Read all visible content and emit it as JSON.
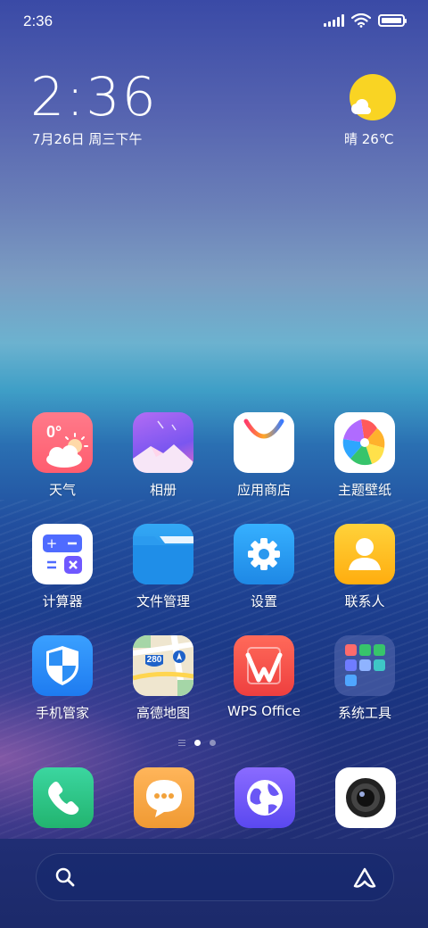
{
  "status_bar": {
    "time": "2:36"
  },
  "clock_widget": {
    "time": "2:36",
    "date": "7月26日 周三下午"
  },
  "weather_widget": {
    "text": "晴 26℃"
  },
  "apps": [
    {
      "label": "天气",
      "icon": "weather-icon",
      "badge": "0°"
    },
    {
      "label": "相册",
      "icon": "gallery-icon"
    },
    {
      "label": "应用商店",
      "icon": "app-store-icon"
    },
    {
      "label": "主题壁纸",
      "icon": "themes-icon"
    },
    {
      "label": "计算器",
      "icon": "calculator-icon"
    },
    {
      "label": "文件管理",
      "icon": "file-manager-icon"
    },
    {
      "label": "设置",
      "icon": "settings-icon"
    },
    {
      "label": "联系人",
      "icon": "contacts-icon"
    },
    {
      "label": "手机管家",
      "icon": "security-icon"
    },
    {
      "label": "高德地图",
      "icon": "amap-icon",
      "badge": "280"
    },
    {
      "label": "WPS Office",
      "icon": "wps-office-icon"
    },
    {
      "label": "系统工具",
      "icon": "system-tools-folder-icon"
    }
  ],
  "dock": [
    {
      "icon": "phone-icon"
    },
    {
      "icon": "messages-icon"
    },
    {
      "icon": "browser-icon"
    },
    {
      "icon": "camera-icon"
    }
  ],
  "page_indicator": {
    "pages": 2,
    "current": 1
  },
  "colors": {
    "weather_sun": "#f9d423",
    "calculator_blue": "#4f6bff",
    "settings_blue": "#1e88e5"
  }
}
